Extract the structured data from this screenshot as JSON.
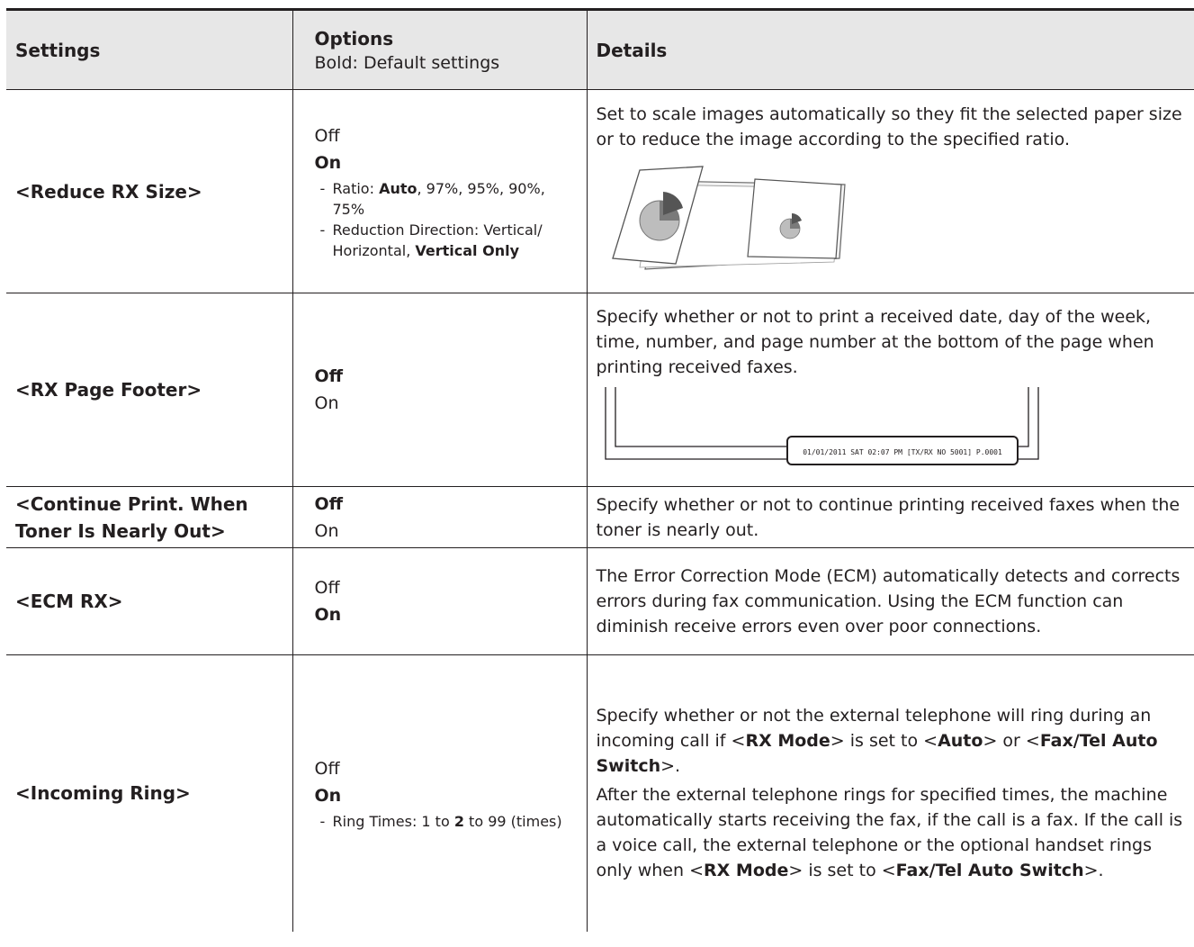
{
  "header": {
    "settings": "Settings",
    "options": "Options",
    "options_note": "Bold: Default settings",
    "details": "Details"
  },
  "rows": [
    {
      "name": "<Reduce RX Size>",
      "options": [
        {
          "text": "Off",
          "default": false
        },
        {
          "text": "On",
          "default": true
        }
      ],
      "sub_options": [
        {
          "prefix": "Ratio: ",
          "bold": "Auto",
          "suffix": ", 97%, 95%, 90%, 75%"
        },
        {
          "prefix": "Reduction Direction: Vertical/ Horizontal, ",
          "bold": "Vertical Only",
          "suffix": ""
        }
      ],
      "details": "Set to scale images automatically so they fit the selected paper size or to reduce the image according to the specified ratio."
    },
    {
      "name": "<RX Page Footer>",
      "options": [
        {
          "text": "Off",
          "default": true
        },
        {
          "text": "On",
          "default": false
        }
      ],
      "details": "Specify whether or not to print a received date, day of the week, time, number, and page number at the bottom of the page when printing received faxes.",
      "footer_sample": "01/01/2011 SAT 02:07 PM [TX/RX NO 5001] P.0001"
    },
    {
      "name": "<Continue Print. When Toner Is Nearly Out>",
      "options": [
        {
          "text": "Off",
          "default": true
        },
        {
          "text": "On",
          "default": false
        }
      ],
      "details": "Specify whether or not to continue printing received faxes when the toner is nearly out."
    },
    {
      "name": "<ECM RX>",
      "options": [
        {
          "text": "Off",
          "default": false
        },
        {
          "text": "On",
          "default": true
        }
      ],
      "details": "The Error Correction Mode (ECM) automatically detects and corrects errors during fax communication. Using the ECM function can diminish receive errors even over poor connections."
    },
    {
      "name": "<Incoming Ring>",
      "options": [
        {
          "text": "Off",
          "default": false
        },
        {
          "text": "On",
          "default": true
        }
      ],
      "sub_options": [
        {
          "prefix": "Ring Times: 1 to ",
          "bold": "2",
          "suffix": " to 99 (times)"
        }
      ],
      "details_parts": [
        {
          "t": "Specify whether or not the external telephone will ring during an incoming call if <",
          "b": false
        },
        {
          "t": "RX Mode",
          "b": true
        },
        {
          "t": "> is set to <",
          "b": false
        },
        {
          "t": "Auto",
          "b": true
        },
        {
          "t": "> or <",
          "b": false
        },
        {
          "t": "Fax/Tel Auto Switch",
          "b": true
        },
        {
          "t": ">.",
          "b": false
        }
      ],
      "details2_parts": [
        {
          "t": "After the external telephone rings for specified times, the machine automatically starts receiving the fax, if the call is a fax. If the call is a voice call, the external telephone or the optional handset rings only when <",
          "b": false
        },
        {
          "t": "RX Mode",
          "b": true
        },
        {
          "t": "> is set to <",
          "b": false
        },
        {
          "t": "Fax/Tel Auto Switch",
          "b": true
        },
        {
          "t": ">.",
          "b": false
        }
      ]
    }
  ]
}
